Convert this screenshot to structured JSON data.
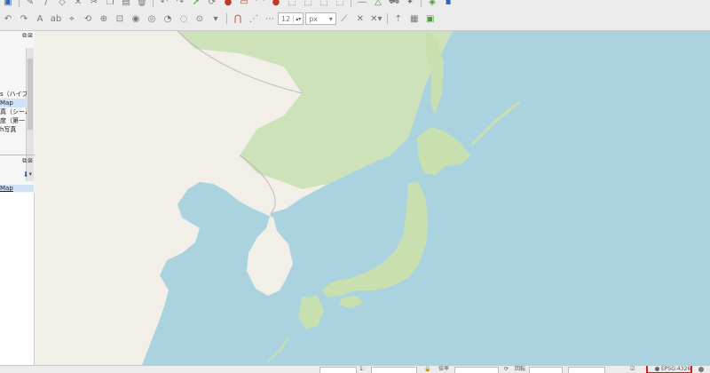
{
  "toolbar": {
    "symbol_size_value": "12",
    "symbol_unit": "px",
    "icons_row1": [
      "save-icon",
      "edit-pencil-icon",
      "toggle-edit-icon",
      "digitize-icon",
      "node-tool-icon",
      "cut-icon",
      "copy-icon",
      "paste-icon",
      "delete-icon",
      "undo-icon",
      "redo-icon",
      "label-icon",
      "tractor-icon",
      "plugin-icon",
      "layer-stack-icon",
      "python-icon"
    ],
    "icons_row2": [
      "undo-icon",
      "redo-icon",
      "text-a-icon",
      "abc-icon",
      "label-pin-icon",
      "label-rotate-icon",
      "label-move-icon",
      "label-change-icon",
      "snap-magnet-icon",
      "snap-vertex-icon",
      "advanced-digitize-icon",
      "angle-icon",
      "intersect-icon",
      "info-i-icon",
      "georef-icon",
      "plugin-box-icon"
    ]
  },
  "layers_panel": {
    "dock_buttons": "⧉⊠",
    "items": [
      {
        "label": "s（ハイブ"
      },
      {
        "label": "Map"
      },
      {
        "label": "真（シーム"
      },
      {
        "label": "度（第一"
      },
      {
        "label": "h写真"
      }
    ]
  },
  "browser_panel": {
    "dock_buttons": "⧉⊠",
    "selected_item": "Map"
  },
  "map": {
    "sea_color": "#aad3df",
    "land_color": "#f2efe9",
    "forest_color": "#c8dfb0",
    "region": "Japan, Korea and Northeast China"
  },
  "statusbar": {
    "crs_label": "EPSG:4326",
    "scale_prefix": "1:",
    "rotation_label": "回転",
    "magnifier_label": "倍率"
  }
}
